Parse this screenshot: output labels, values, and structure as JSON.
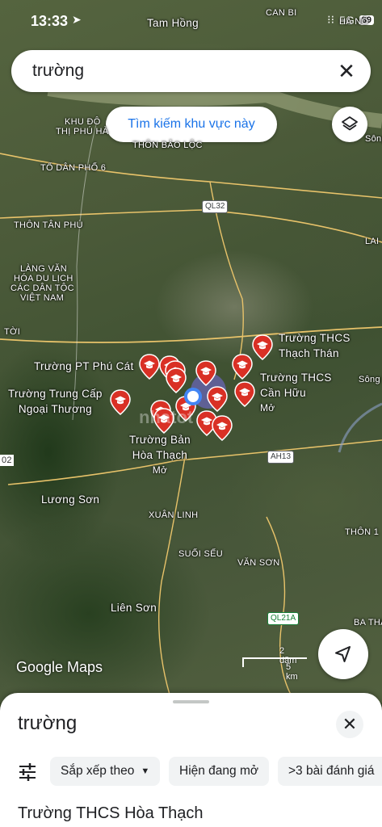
{
  "status_bar": {
    "time": "13:33",
    "network": "5G",
    "battery": "89"
  },
  "search": {
    "query": "trường"
  },
  "map": {
    "search_area_button": "Tìm kiếm khu vực này",
    "labels": {
      "l1": "Tam Hồng",
      "l2": "CAN BI",
      "l3": "HÀ NÔ",
      "l4": "KHU ĐÔ",
      "l5": "THỊ PHÚ HÀ",
      "l6": "THÔN BẢO LỘC",
      "l7": "TỔ DÂN PHỐ 6",
      "l8": "THÔN TÂN PHÚ",
      "l9": "LÀNG VĂN",
      "l10": "HÓA DU LỊCH",
      "l11": "CÁC DÂN TỘC",
      "l12": "VIỆT NAM",
      "l13": "TỜI",
      "l14": "LAI",
      "l15": "Sông",
      "l16": "Sông Đà",
      "l17": "Trường THCS",
      "l18": "Thạch Thán",
      "l19": "Trường PT Phú Cát",
      "l20": "Trường THCS",
      "l21": "Cần Hữu",
      "l22": "Mở",
      "l23": "Trường Trung Cấp",
      "l24": "Ngoại Thương",
      "l25": "Trường Bản",
      "l26": "Hòa Thạch",
      "l27": "Mở",
      "l28": "02",
      "l29": "Lương Sơn",
      "l30": "XUÂN LINH",
      "l31": "THÔN 1",
      "l32": "SUỐI SẾU",
      "l33": "VĂN SƠN",
      "l34": "Liên Sơn",
      "l35": "BA THA"
    },
    "roads": {
      "ql32": "QL32",
      "ah13": "AH13",
      "ql21a": "QL21A"
    },
    "watermark": "nhatot",
    "scale_miles": "2 dặm",
    "scale_km": "5 km",
    "attribution": "Google Maps"
  },
  "sheet": {
    "title": "trường",
    "filters": {
      "sort": "Sắp xếp theo",
      "open_now": "Hiện đang mở",
      "rating": ">3 bài đánh giá"
    },
    "first_result": "Trường THCS Hòa Thạch"
  },
  "colors": {
    "pin": "#d93025",
    "accent": "#1a73e8",
    "location": "#4285f4"
  }
}
